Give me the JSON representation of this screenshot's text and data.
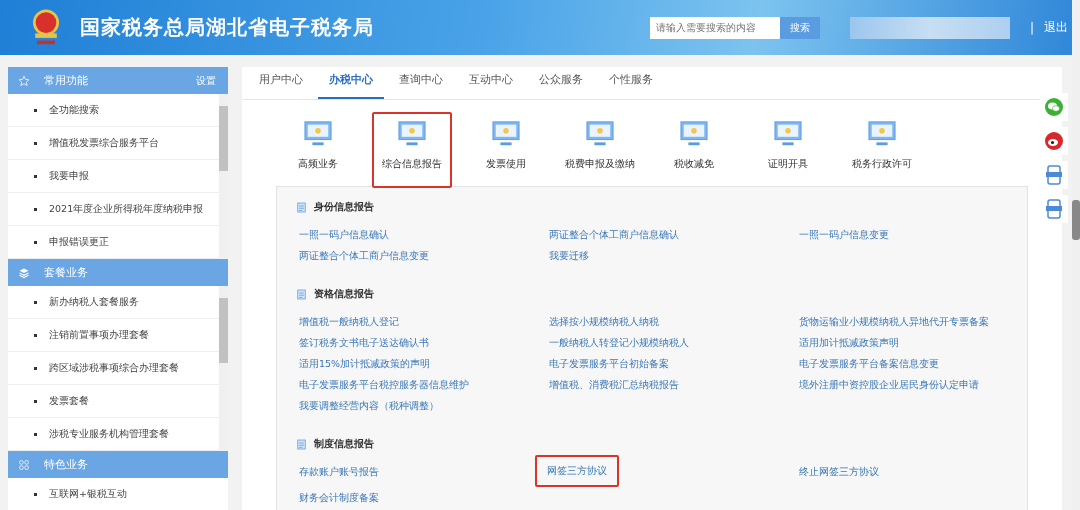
{
  "header": {
    "title": "国家税务总局湖北省电子税务局",
    "search": {
      "placeholder": "请输入需要搜索的内容",
      "button": "搜索"
    },
    "separator": "|",
    "logout": "退出"
  },
  "sidebar": [
    {
      "kind": "star",
      "title": "常用功能",
      "action": "设置",
      "items": [
        "全功能搜索",
        "增值税发票综合服务平台",
        "我要申报",
        "2021年度企业所得税年度纳税申报",
        "申报错误更正"
      ]
    },
    {
      "kind": "layers",
      "title": "套餐业务",
      "items": [
        "新办纳税人套餐服务",
        "注销前置事项办理套餐",
        "跨区域涉税事项综合办理套餐",
        "发票套餐",
        "涉税专业服务机构管理套餐"
      ]
    },
    {
      "kind": "grid",
      "title": "特色业务",
      "items": [
        "互联网+银税互动"
      ]
    }
  ],
  "tabs": [
    {
      "label": "用户中心",
      "selected": false
    },
    {
      "label": "办税中心",
      "selected": true
    },
    {
      "label": "查询中心",
      "selected": false
    },
    {
      "label": "互动中心",
      "selected": false
    },
    {
      "label": "公众服务",
      "selected": false
    },
    {
      "label": "个性服务",
      "selected": false
    }
  ],
  "categories": [
    {
      "label": "高频业务",
      "highlighted": false
    },
    {
      "label": "综合信息报告",
      "highlighted": true
    },
    {
      "label": "发票使用",
      "highlighted": false
    },
    {
      "label": "税费申报及缴纳",
      "highlighted": false
    },
    {
      "label": "税收减免",
      "highlighted": false
    },
    {
      "label": "证明开具",
      "highlighted": false
    },
    {
      "label": "税务行政许可",
      "highlighted": false
    }
  ],
  "sections": [
    {
      "title": "身份信息报告",
      "links": [
        {
          "label": "一照一码户信息确认",
          "highlighted": false
        },
        {
          "label": "两证整合个体工商户信息确认",
          "highlighted": false
        },
        {
          "label": "一照一码户信息变更",
          "highlighted": false
        },
        {
          "label": "两证整合个体工商户信息变更",
          "highlighted": false
        },
        {
          "label": "我要迁移",
          "highlighted": false
        }
      ]
    },
    {
      "title": "资格信息报告",
      "links": [
        {
          "label": "增值税一般纳税人登记",
          "highlighted": false
        },
        {
          "label": "选择按小规模纳税人纳税",
          "highlighted": false
        },
        {
          "label": "货物运输业小规模纳税人异地代开专票备案",
          "highlighted": false
        },
        {
          "label": "签订税务文书电子送达确认书",
          "highlighted": false
        },
        {
          "label": "一般纳税人转登记小规模纳税人",
          "highlighted": false
        },
        {
          "label": "适用加计抵减政策声明",
          "highlighted": false
        },
        {
          "label": "适用15%加计抵减政策的声明",
          "highlighted": false
        },
        {
          "label": "电子发票服务平台初始备案",
          "highlighted": false
        },
        {
          "label": "电子发票服务平台备案信息变更",
          "highlighted": false
        },
        {
          "label": "电子发票服务平台税控服务器信息维护",
          "highlighted": false
        },
        {
          "label": "增值税、消费税汇总纳税报告",
          "highlighted": false
        },
        {
          "label": "境外注册中资控股企业居民身份认定申请",
          "highlighted": false
        },
        {
          "label": "我要调整经营内容（税种调整）",
          "highlighted": false
        }
      ]
    },
    {
      "title": "制度信息报告",
      "links": [
        {
          "label": "存款账户账号报告",
          "highlighted": false
        },
        {
          "label": "网签三方协议",
          "highlighted": true
        },
        {
          "label": "终止网签三方协议",
          "highlighted": false
        },
        {
          "label": "财务会计制度备案",
          "highlighted": false
        }
      ]
    }
  ],
  "side_tools": [
    {
      "kind": "wechat"
    },
    {
      "kind": "weibo"
    },
    {
      "kind": "app"
    },
    {
      "kind": "app"
    }
  ]
}
